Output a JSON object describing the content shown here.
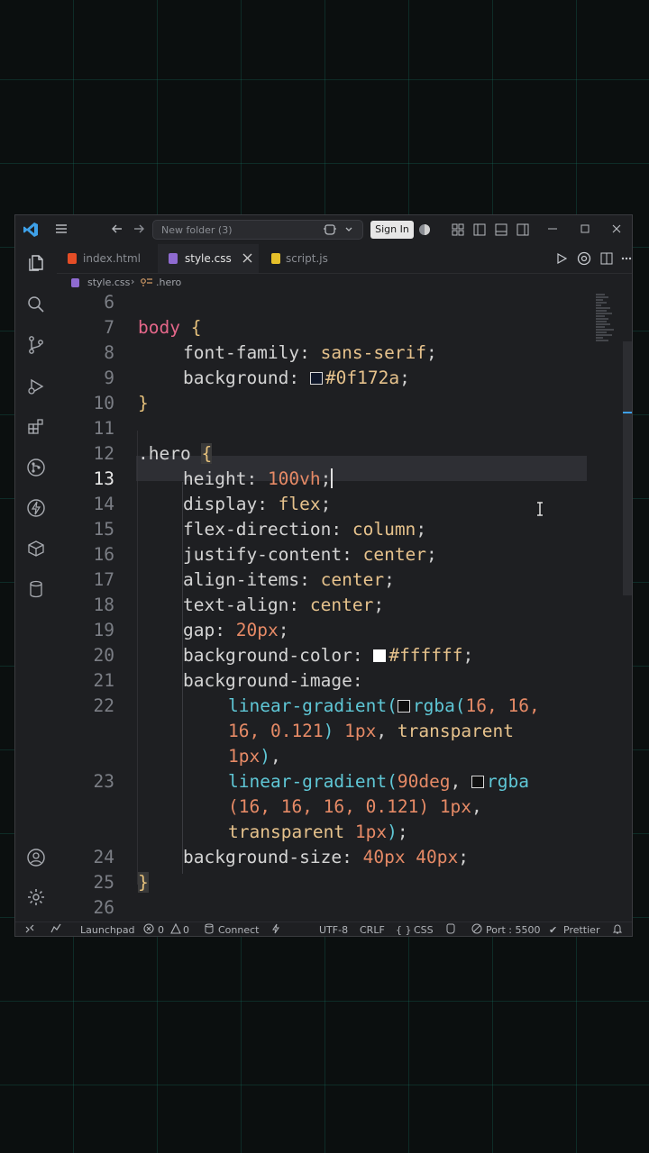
{
  "titlebar": {
    "search_placeholder": "New folder (3)",
    "signin_label": "Sign In"
  },
  "tabs": [
    {
      "label": "index.html",
      "icon": "html-file-icon",
      "color": "#e44d26"
    },
    {
      "label": "style.css",
      "icon": "css-file-icon",
      "color": "#8f6bd1",
      "active": true
    },
    {
      "label": "script.js",
      "icon": "js-file-icon",
      "color": "#e6c02a"
    }
  ],
  "breadcrumbs": {
    "file": "style.css",
    "symbol": ".hero"
  },
  "editor": {
    "current_line": 13,
    "lines": [
      {
        "n": "6"
      },
      {
        "n": "7"
      },
      {
        "n": "8"
      },
      {
        "n": "9"
      },
      {
        "n": "10"
      },
      {
        "n": "11"
      },
      {
        "n": "12"
      },
      {
        "n": "13"
      },
      {
        "n": "14"
      },
      {
        "n": "15"
      },
      {
        "n": "16"
      },
      {
        "n": "17"
      },
      {
        "n": "18"
      },
      {
        "n": "19"
      },
      {
        "n": "20"
      },
      {
        "n": "21"
      },
      {
        "n": "22"
      },
      {
        "n": "23"
      },
      {
        "n": "24"
      },
      {
        "n": "25"
      },
      {
        "n": "26"
      }
    ],
    "code": {
      "l7_sel": "body",
      "l7_brace": "{",
      "l8_prop": "font-family",
      "l8_val": "sans-serif",
      "l9_prop": "background",
      "l9_val": "#0f172a",
      "l10_brace": "}",
      "l12_sel": ".hero",
      "l12_brace": "{",
      "l13_prop": "height",
      "l13_num": "100vh",
      "l14_prop": "display",
      "l14_val": "flex",
      "l15_prop": "flex-direction",
      "l15_val": "column",
      "l16_prop": "justify-content",
      "l16_val": "center",
      "l17_prop": "align-items",
      "l17_val": "center",
      "l18_prop": "text-align",
      "l18_val": "center",
      "l19_prop": "gap",
      "l19_num": "20px",
      "l20_prop": "background-color",
      "l20_val": "#ffffff",
      "l21_prop": "background-image",
      "l22a_fn": "linear-gradient(",
      "l22a_fn2": "rgba(",
      "l22a_num": "16, 16,",
      "l22b_num": "16, 0.121",
      "l22b_num2": "1px",
      "l22b_val": "transparent",
      "l22c_num": "1px",
      "l23a_fn": "linear-gradient(",
      "l23a_num": "90deg",
      "l23a_fn2": "rgba",
      "l23b_num": "(16, 16, 16, 0.121)",
      "l23b_num2": "1px",
      "l23c_val": "transparent",
      "l23c_num": "1px",
      "l24_prop": "background-size",
      "l24_num": "40px 40px",
      "l25_brace": "}"
    },
    "swatches": {
      "dark": "#0f172a",
      "white": "#ffffff",
      "gray": "#101010"
    }
  },
  "statusbar": {
    "launchpad": "Launchpad",
    "errors": "0",
    "warnings": "0",
    "connect": "Connect",
    "encoding": "UTF-8",
    "eol": "CRLF",
    "language": "CSS",
    "port": "Port : 5500",
    "formatter": "Prettier"
  }
}
